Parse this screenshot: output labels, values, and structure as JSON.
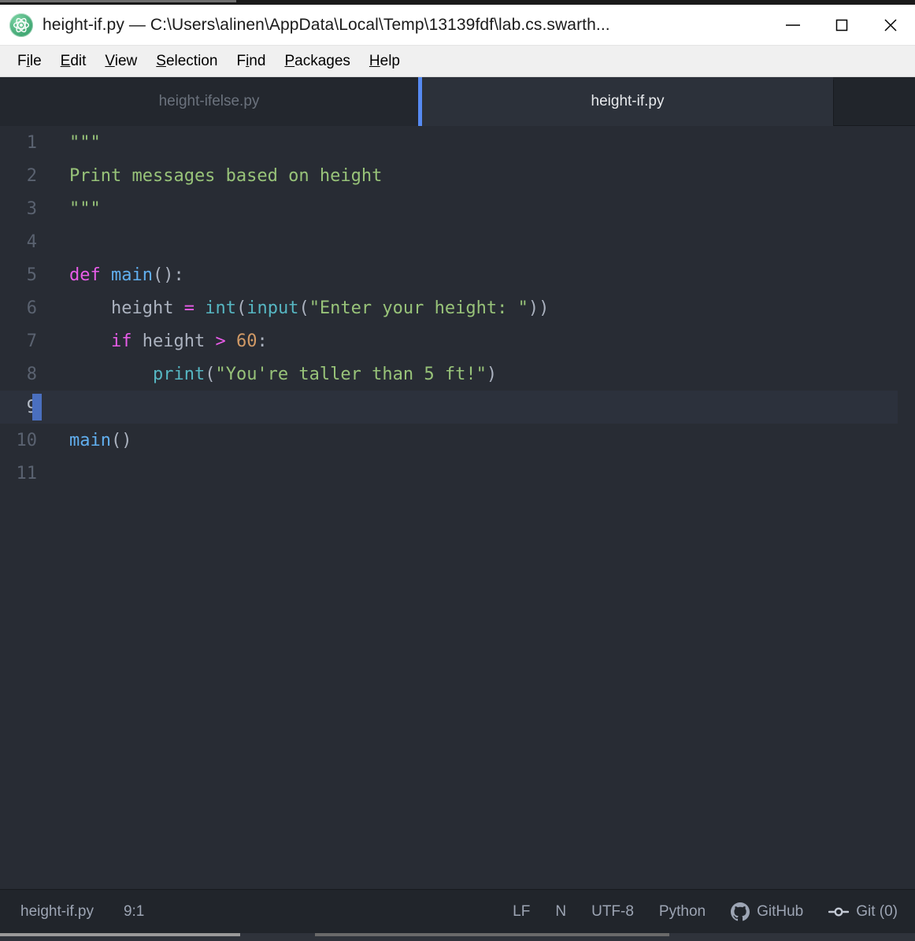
{
  "window": {
    "title": "height-if.py — C:\\Users\\alinen\\AppData\\Local\\Temp\\13139fdf\\lab.cs.swarth...",
    "app_icon": "atom-logo-icon",
    "controls": {
      "minimize": "minimize-icon",
      "maximize": "maximize-icon",
      "close": "close-icon"
    }
  },
  "menubar": {
    "items": [
      {
        "label": "File",
        "pre": "F",
        "mnemonic": "i",
        "post": "le"
      },
      {
        "label": "Edit",
        "pre": "",
        "mnemonic": "E",
        "post": "dit"
      },
      {
        "label": "View",
        "pre": "",
        "mnemonic": "V",
        "post": "iew"
      },
      {
        "label": "Selection",
        "pre": "",
        "mnemonic": "S",
        "post": "election"
      },
      {
        "label": "Find",
        "pre": "F",
        "mnemonic": "i",
        "post": "nd"
      },
      {
        "label": "Packages",
        "pre": "",
        "mnemonic": "P",
        "post": "ackages"
      },
      {
        "label": "Help",
        "pre": "",
        "mnemonic": "H",
        "post": "elp"
      }
    ]
  },
  "tabs": [
    {
      "label": "height-ifelse.py",
      "active": false
    },
    {
      "label": "height-if.py",
      "active": true
    }
  ],
  "editor": {
    "active_line": 9,
    "cursor": "9:1",
    "lines": [
      {
        "n": "1",
        "tokens": [
          {
            "t": "\"\"\"",
            "c": "s-str"
          }
        ]
      },
      {
        "n": "2",
        "tokens": [
          {
            "t": "Print messages based on height",
            "c": "s-str"
          }
        ]
      },
      {
        "n": "3",
        "tokens": [
          {
            "t": "\"\"\"",
            "c": "s-str"
          }
        ]
      },
      {
        "n": "4",
        "tokens": []
      },
      {
        "n": "5",
        "tokens": [
          {
            "t": "def ",
            "c": "s-kw"
          },
          {
            "t": "main",
            "c": "s-fn"
          },
          {
            "t": "():",
            "c": "s-punc"
          }
        ]
      },
      {
        "n": "6",
        "tokens": [
          {
            "t": "    height ",
            "c": "s-plain"
          },
          {
            "t": "=",
            "c": "s-op"
          },
          {
            "t": " ",
            "c": "s-plain"
          },
          {
            "t": "int",
            "c": "s-bi"
          },
          {
            "t": "(",
            "c": "s-punc"
          },
          {
            "t": "input",
            "c": "s-bi"
          },
          {
            "t": "(",
            "c": "s-punc"
          },
          {
            "t": "\"Enter your height: \"",
            "c": "s-str"
          },
          {
            "t": "))",
            "c": "s-punc"
          }
        ]
      },
      {
        "n": "7",
        "tokens": [
          {
            "t": "    ",
            "c": "s-plain"
          },
          {
            "t": "if",
            "c": "s-kw"
          },
          {
            "t": " height ",
            "c": "s-plain"
          },
          {
            "t": ">",
            "c": "s-op"
          },
          {
            "t": " ",
            "c": "s-plain"
          },
          {
            "t": "60",
            "c": "s-num"
          },
          {
            "t": ":",
            "c": "s-punc"
          }
        ]
      },
      {
        "n": "8",
        "tokens": [
          {
            "t": "        ",
            "c": "s-plain"
          },
          {
            "t": "print",
            "c": "s-bi"
          },
          {
            "t": "(",
            "c": "s-punc"
          },
          {
            "t": "\"You're taller than 5 ft!\"",
            "c": "s-str"
          },
          {
            "t": ")",
            "c": "s-punc"
          }
        ]
      },
      {
        "n": "9",
        "tokens": []
      },
      {
        "n": "10",
        "tokens": [
          {
            "t": "main",
            "c": "s-fn"
          },
          {
            "t": "()",
            "c": "s-punc"
          }
        ]
      },
      {
        "n": "11",
        "tokens": []
      }
    ]
  },
  "statusbar": {
    "filename": "height-if.py",
    "cursor_position": "9:1",
    "line_ending": "LF",
    "selection_mode": "N",
    "encoding": "UTF-8",
    "grammar": "Python",
    "github": "GitHub",
    "git": "Git (0)",
    "github_icon": "github-icon",
    "git_icon": "git-commit-icon"
  },
  "colors": {
    "accent_tab": "#568af2",
    "editor_bg": "#282c34",
    "chrome_bg": "#21252b",
    "string": "#98c379",
    "keyword": "#e85ce8",
    "function": "#61afef",
    "builtin": "#56b6c2",
    "number": "#d19a66",
    "plain": "#abb2bf",
    "cursor": "#4a6fbf"
  }
}
